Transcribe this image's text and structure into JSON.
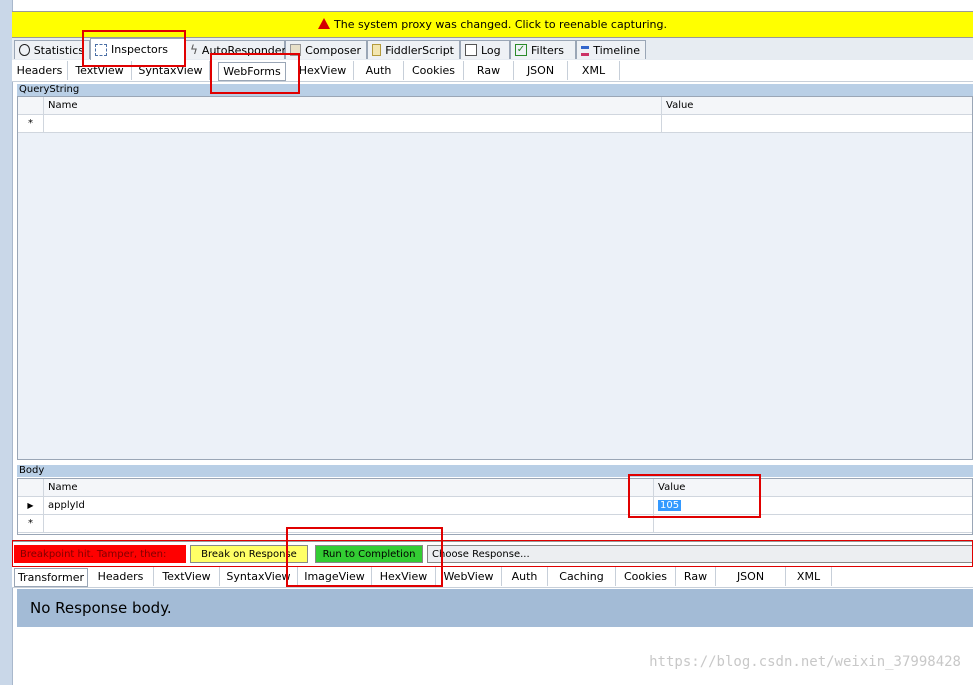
{
  "banner": {
    "text": "The system proxy was changed. Click to reenable capturing."
  },
  "main_tabs": [
    {
      "label": "Statistics",
      "icon": "stopwatch-icon"
    },
    {
      "label": "Inspectors",
      "icon": "magnifier-icon"
    },
    {
      "label": "AutoResponder",
      "icon": "lightning-icon"
    },
    {
      "label": "Composer",
      "icon": "pencil-icon"
    },
    {
      "label": "FiddlerScript",
      "icon": "script-icon"
    },
    {
      "label": "Log",
      "icon": "log-icon"
    },
    {
      "label": "Filters",
      "icon": "checkbox-icon"
    },
    {
      "label": "Timeline",
      "icon": "timeline-icon"
    }
  ],
  "request_tabs": [
    "Headers",
    "TextView",
    "SyntaxView",
    "WebForms",
    "HexView",
    "Auth",
    "Cookies",
    "Raw",
    "JSON",
    "XML"
  ],
  "querystring": {
    "label": "QueryString",
    "col_name": "Name",
    "col_value": "Value",
    "new_row_marker": "*"
  },
  "body": {
    "label": "Body",
    "col_name": "Name",
    "col_value": "Value",
    "rows": [
      {
        "name": "applyId",
        "value": "105"
      }
    ],
    "new_row_marker": "*"
  },
  "breakpoint": {
    "label": "Breakpoint hit. Tamper, then:",
    "break_on_response": "Break on Response",
    "run_to_completion": "Run to Completion",
    "choose_response": "Choose Response..."
  },
  "response_tabs": [
    "Transformer",
    "Headers",
    "TextView",
    "SyntaxView",
    "ImageView",
    "HexView",
    "WebView",
    "Auth",
    "Caching",
    "Cookies",
    "Raw",
    "JSON",
    "XML"
  ],
  "response_body": {
    "text": "No Response body."
  },
  "watermark": {
    "text": "https://blog.csdn.net/weixin_37998428"
  },
  "colors": {
    "banner": "#ffff00",
    "breakpoint": "#ff0000",
    "break_button": "#ffff66",
    "run_button": "#33cc33",
    "highlight": "#e00000"
  }
}
